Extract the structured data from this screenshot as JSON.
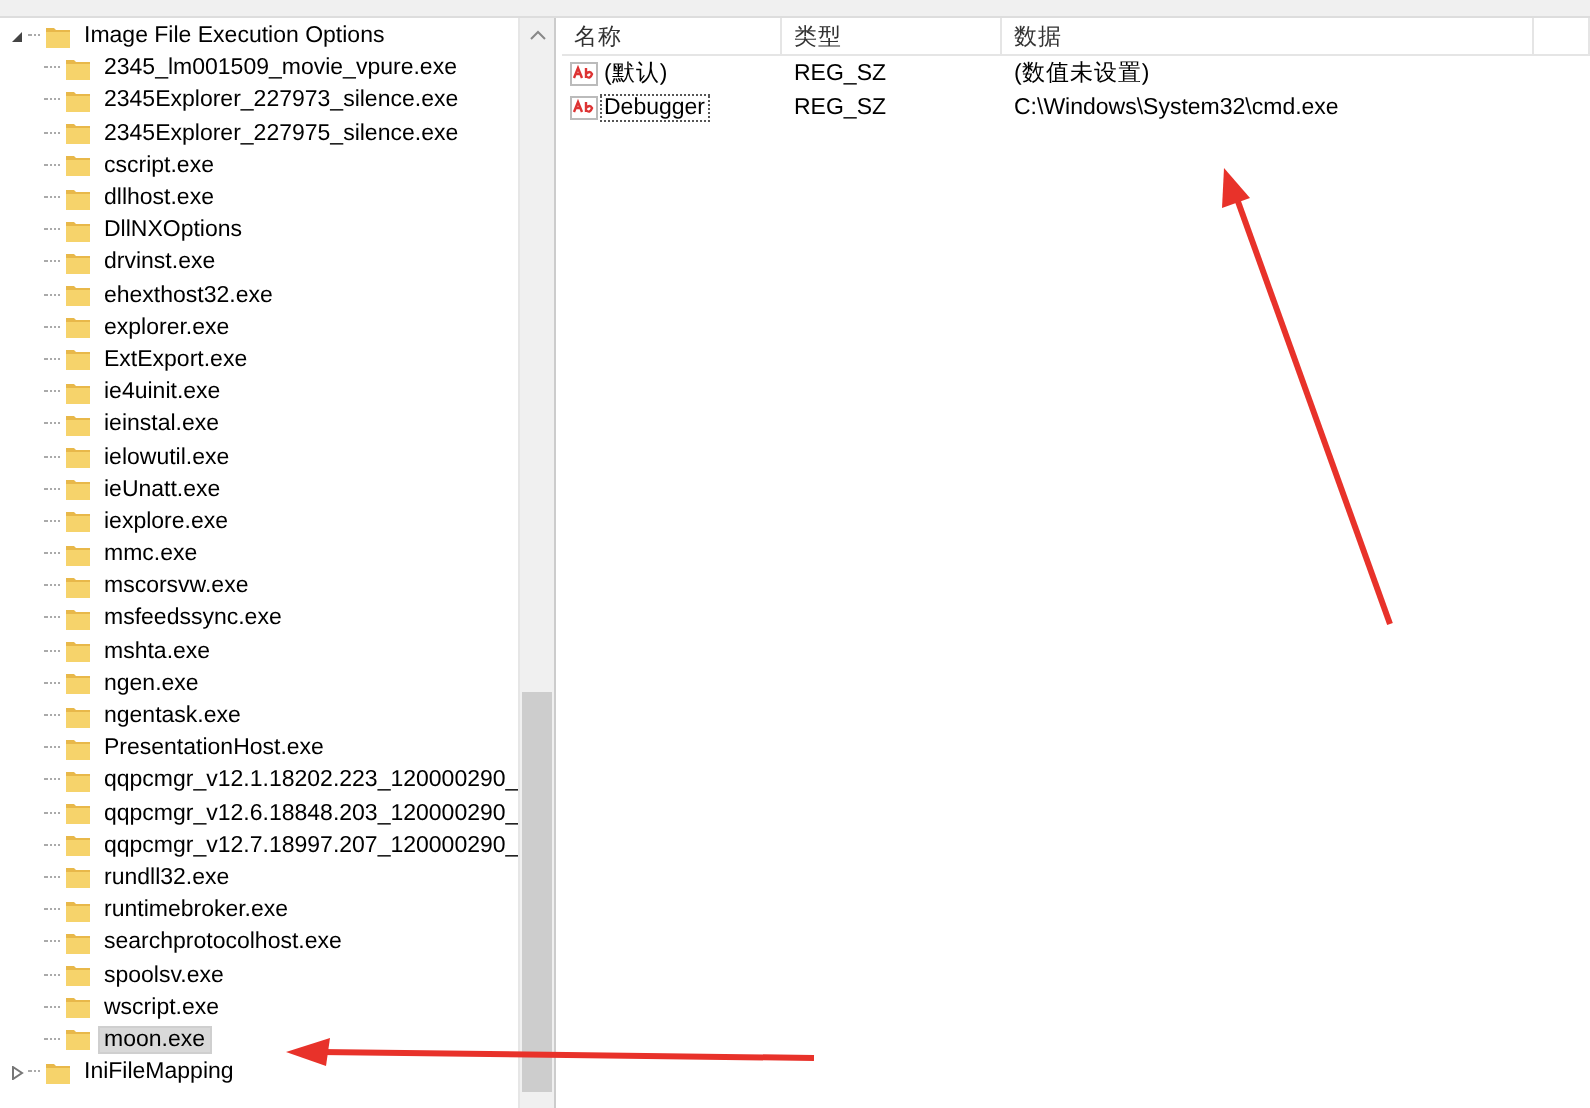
{
  "tree": [
    {
      "label": "Image File Execution Options",
      "expanded": true,
      "selected": false,
      "children": [
        {
          "label": "2345_lm001509_movie_vpure.exe",
          "selected": false
        },
        {
          "label": "2345Explorer_227973_silence.exe",
          "selected": false
        },
        {
          "label": "2345Explorer_227975_silence.exe",
          "selected": false
        },
        {
          "label": "cscript.exe",
          "selected": false
        },
        {
          "label": "dllhost.exe",
          "selected": false
        },
        {
          "label": "DllNXOptions",
          "selected": false
        },
        {
          "label": "drvinst.exe",
          "selected": false
        },
        {
          "label": "ehexthost32.exe",
          "selected": false
        },
        {
          "label": "explorer.exe",
          "selected": false
        },
        {
          "label": "ExtExport.exe",
          "selected": false
        },
        {
          "label": "ie4uinit.exe",
          "selected": false
        },
        {
          "label": "ieinstal.exe",
          "selected": false
        },
        {
          "label": "ielowutil.exe",
          "selected": false
        },
        {
          "label": "ieUnatt.exe",
          "selected": false
        },
        {
          "label": "iexplore.exe",
          "selected": false
        },
        {
          "label": "mmc.exe",
          "selected": false
        },
        {
          "label": "mscorsvw.exe",
          "selected": false
        },
        {
          "label": "msfeedssync.exe",
          "selected": false
        },
        {
          "label": "mshta.exe",
          "selected": false
        },
        {
          "label": "ngen.exe",
          "selected": false
        },
        {
          "label": "ngentask.exe",
          "selected": false
        },
        {
          "label": "PresentationHost.exe",
          "selected": false
        },
        {
          "label": "qqpcmgr_v12.1.18202.223_120000290_",
          "selected": false
        },
        {
          "label": "qqpcmgr_v12.6.18848.203_120000290_",
          "selected": false
        },
        {
          "label": "qqpcmgr_v12.7.18997.207_120000290_",
          "selected": false
        },
        {
          "label": "rundll32.exe",
          "selected": false
        },
        {
          "label": "runtimebroker.exe",
          "selected": false
        },
        {
          "label": "searchprotocolhost.exe",
          "selected": false
        },
        {
          "label": "spoolsv.exe",
          "selected": false
        },
        {
          "label": "wscript.exe",
          "selected": false
        },
        {
          "label": "moon.exe",
          "selected": true
        }
      ]
    },
    {
      "label": "IniFileMapping",
      "expanded": false,
      "selected": false
    }
  ],
  "values": {
    "columns": [
      "名称",
      "类型",
      "数据"
    ],
    "rows": [
      {
        "name": "(默认)",
        "type": "REG_SZ",
        "data": "(数值未设置)",
        "selected": false
      },
      {
        "name": "Debugger",
        "type": "REG_SZ",
        "data": "C:\\Windows\\System32\\cmd.exe",
        "selected": true
      }
    ]
  }
}
